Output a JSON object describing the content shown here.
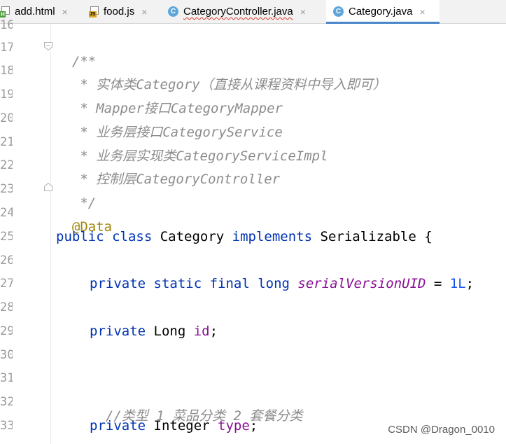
{
  "tabs": [
    {
      "label": "add.html",
      "close": "×",
      "icon": "html-file-icon"
    },
    {
      "label": "food.js",
      "close": "×",
      "icon": "js-file-icon"
    },
    {
      "label": "CategoryController.java",
      "close": "×",
      "icon": "java-class-icon"
    },
    {
      "label": "Category.java",
      "close": "×",
      "icon": "java-class-icon",
      "active": true
    }
  ],
  "editor": {
    "line_numbers": [
      "16",
      "17",
      "18",
      "19",
      "20",
      "21",
      "22",
      "23",
      "24",
      "25",
      "26",
      "27",
      "28",
      "29",
      "30",
      "31",
      "32",
      "33"
    ],
    "code": {
      "l17_cmt": "/**",
      "l18_cmt": " * 实体类Category（直接从课程资料中导入即可）",
      "l19_cmt": " * Mapper接口CategoryMapper",
      "l20_cmt": " * 业务层接口CategoryService",
      "l21_cmt": " * 业务层实现类CategoryServiceImpl",
      "l22_cmt": " * 控制层CategoryController",
      "l23_cmt": " */",
      "l24_ann": "@Data",
      "l25_kw1": "public class ",
      "l25_txt1": "Category ",
      "l25_kw2": "implements ",
      "l25_txt2": "Serializable {",
      "l27_kw": "private static final long ",
      "l27_fld": "serialVersionUID",
      "l27_eq": " = ",
      "l27_num": "1L",
      "l27_end": ";",
      "l29_kw": "private ",
      "l29_type": "Long ",
      "l29_fld": "id",
      "l29_end": ";",
      "l32_cmt": "//类型 1 菜品分类 2 套餐分类",
      "l33_kw": "private ",
      "l33_type": "Integer ",
      "l33_fld": "type",
      "l33_end": ";"
    }
  },
  "watermark": "CSDN @Dragon_0010",
  "colors": {
    "keyword": "#0033b3",
    "comment": "#8c8c8c",
    "annotation": "#9e880d",
    "field": "#871094",
    "number": "#1750eb",
    "active_tab_underline": "#4a86c8"
  }
}
